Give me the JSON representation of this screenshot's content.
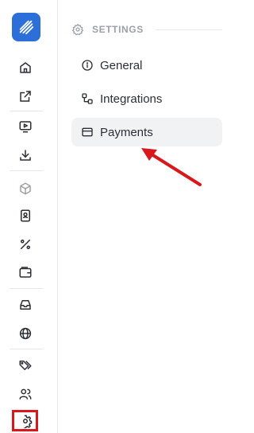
{
  "settings": {
    "header": "SETTINGS",
    "items": [
      {
        "label": "General",
        "icon": "info-icon"
      },
      {
        "label": "Integrations",
        "icon": "integrations-icon"
      },
      {
        "label": "Payments",
        "icon": "credit-card-icon"
      }
    ]
  },
  "sidebar": {
    "icons": [
      "home-icon",
      "external-link-icon",
      "monitor-play-icon",
      "download-icon",
      "package-icon",
      "contact-book-icon",
      "percent-icon",
      "wallet-icon",
      "inbox-icon",
      "globe-icon",
      "tags-icon",
      "users-icon",
      "settings-icon"
    ]
  },
  "colors": {
    "brand": "#2d6fd8",
    "highlight": "#d9181c",
    "active_bg": "#f1f2f4"
  }
}
